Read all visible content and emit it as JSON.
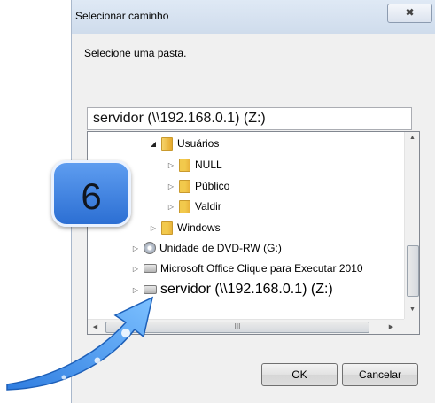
{
  "dialog": {
    "title": "Selecionar caminho",
    "close_label": "✖",
    "prompt": "Selecione uma pasta.",
    "path_value": "servidor (\\\\192.168.0.1) (Z:)",
    "ok_label": "OK",
    "cancel_label": "Cancelar"
  },
  "tree": {
    "items": [
      {
        "label": "Usuários",
        "expanded": true,
        "icon": "user-folder-icon"
      },
      {
        "label": "NULL",
        "expanded": false,
        "icon": "folder-icon"
      },
      {
        "label": "Público",
        "expanded": false,
        "icon": "folder-icon"
      },
      {
        "label": "Valdir",
        "expanded": false,
        "icon": "folder-icon"
      },
      {
        "label": "Windows",
        "expanded": false,
        "icon": "folder-icon"
      },
      {
        "label": "Unidade de DVD-RW (G:)",
        "expanded": false,
        "icon": "dvd-drive-icon"
      },
      {
        "label": "Microsoft Office Clique para Executar 2010",
        "expanded": false,
        "icon": "drive-icon"
      },
      {
        "label": "servidor (\\\\192.168.0.1) (Z:)",
        "expanded": false,
        "icon": "network-drive-icon"
      }
    ]
  },
  "scrollbar": {
    "h_thumb_glyph": "III"
  },
  "annotation": {
    "step_number": "6",
    "accent": "#2c6fd3"
  }
}
